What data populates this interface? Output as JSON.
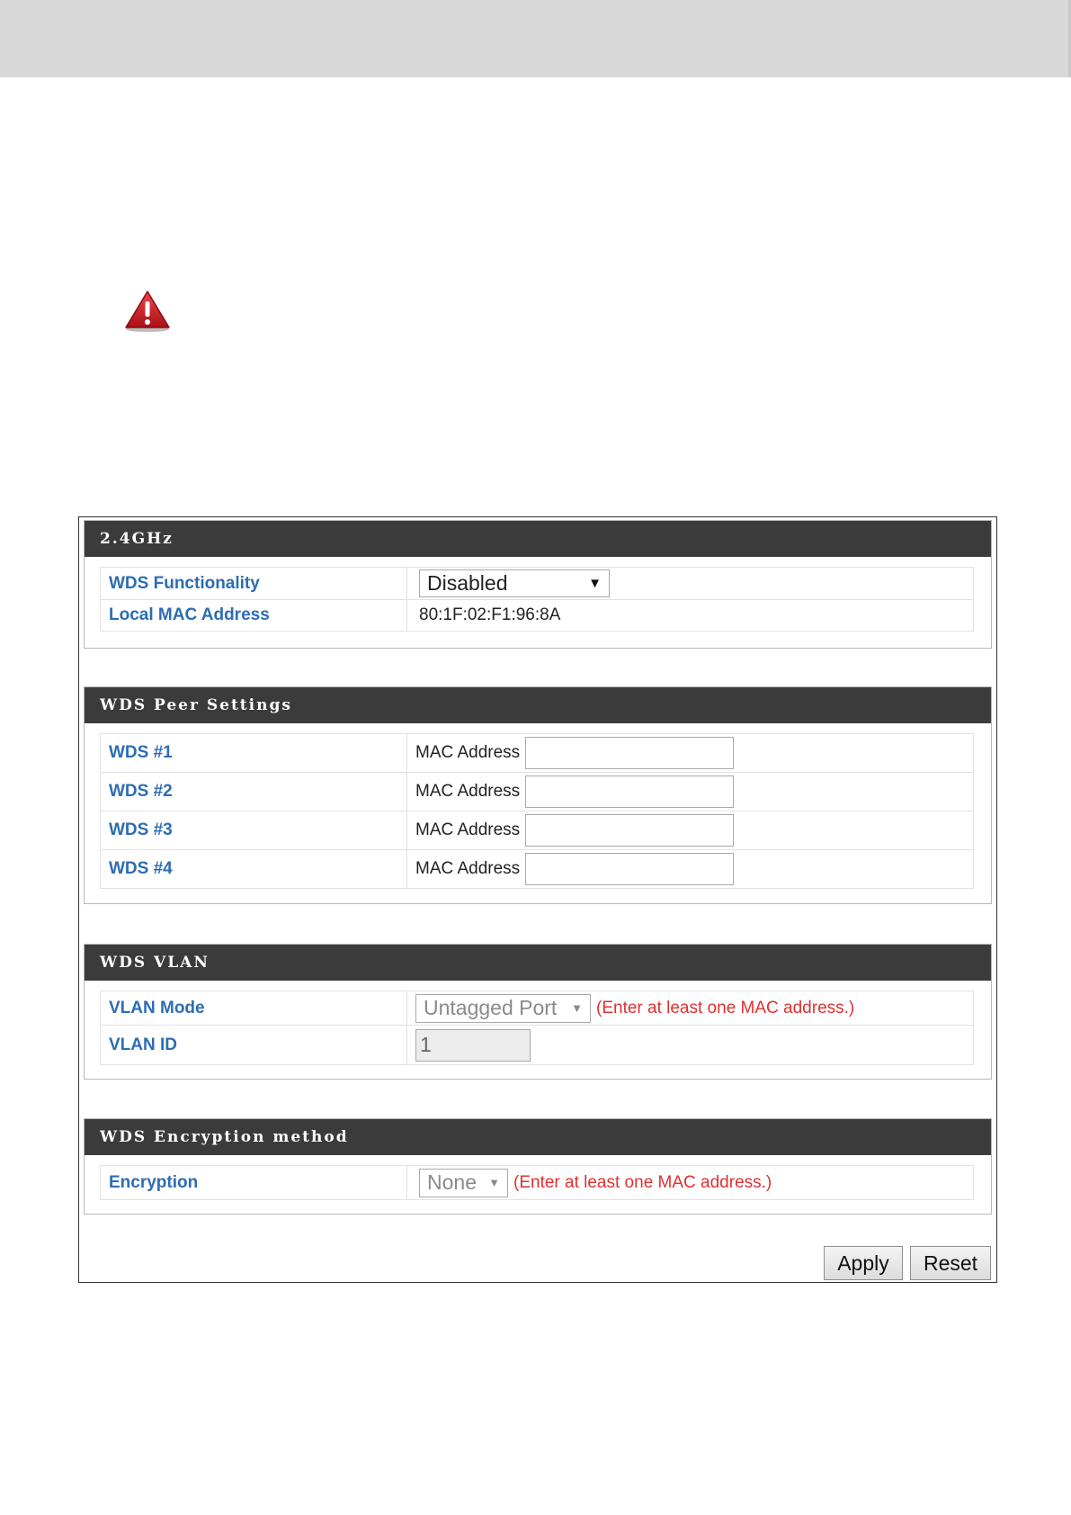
{
  "section_24ghz": {
    "title": "2.4GHz",
    "wds_functionality_label": "WDS Functionality",
    "wds_functionality_value": "Disabled",
    "local_mac_label": "Local MAC Address",
    "local_mac_value": "80:1F:02:F1:96:8A"
  },
  "peer_settings": {
    "title": "WDS Peer Settings",
    "mac_field_label": "MAC Address",
    "peers": [
      {
        "label": "WDS #1",
        "value": ""
      },
      {
        "label": "WDS #2",
        "value": ""
      },
      {
        "label": "WDS #3",
        "value": ""
      },
      {
        "label": "WDS #4",
        "value": ""
      }
    ]
  },
  "vlan": {
    "title": "WDS VLAN",
    "mode_label": "VLAN Mode",
    "mode_value": "Untagged Port",
    "mode_hint": "(Enter at least one MAC address.)",
    "id_label": "VLAN ID",
    "id_value": "1"
  },
  "encryption": {
    "title": "WDS Encryption method",
    "label": "Encryption",
    "value": "None",
    "hint": "(Enter at least one MAC address.)"
  },
  "buttons": {
    "apply": "Apply",
    "reset": "Reset"
  },
  "colors": {
    "label_blue": "#2c6db3",
    "header_dark": "#3b3b3b",
    "hint_red": "#e03030",
    "warning_red": "#c8171e"
  },
  "icons": {
    "warning": "warning-triangle-icon"
  }
}
